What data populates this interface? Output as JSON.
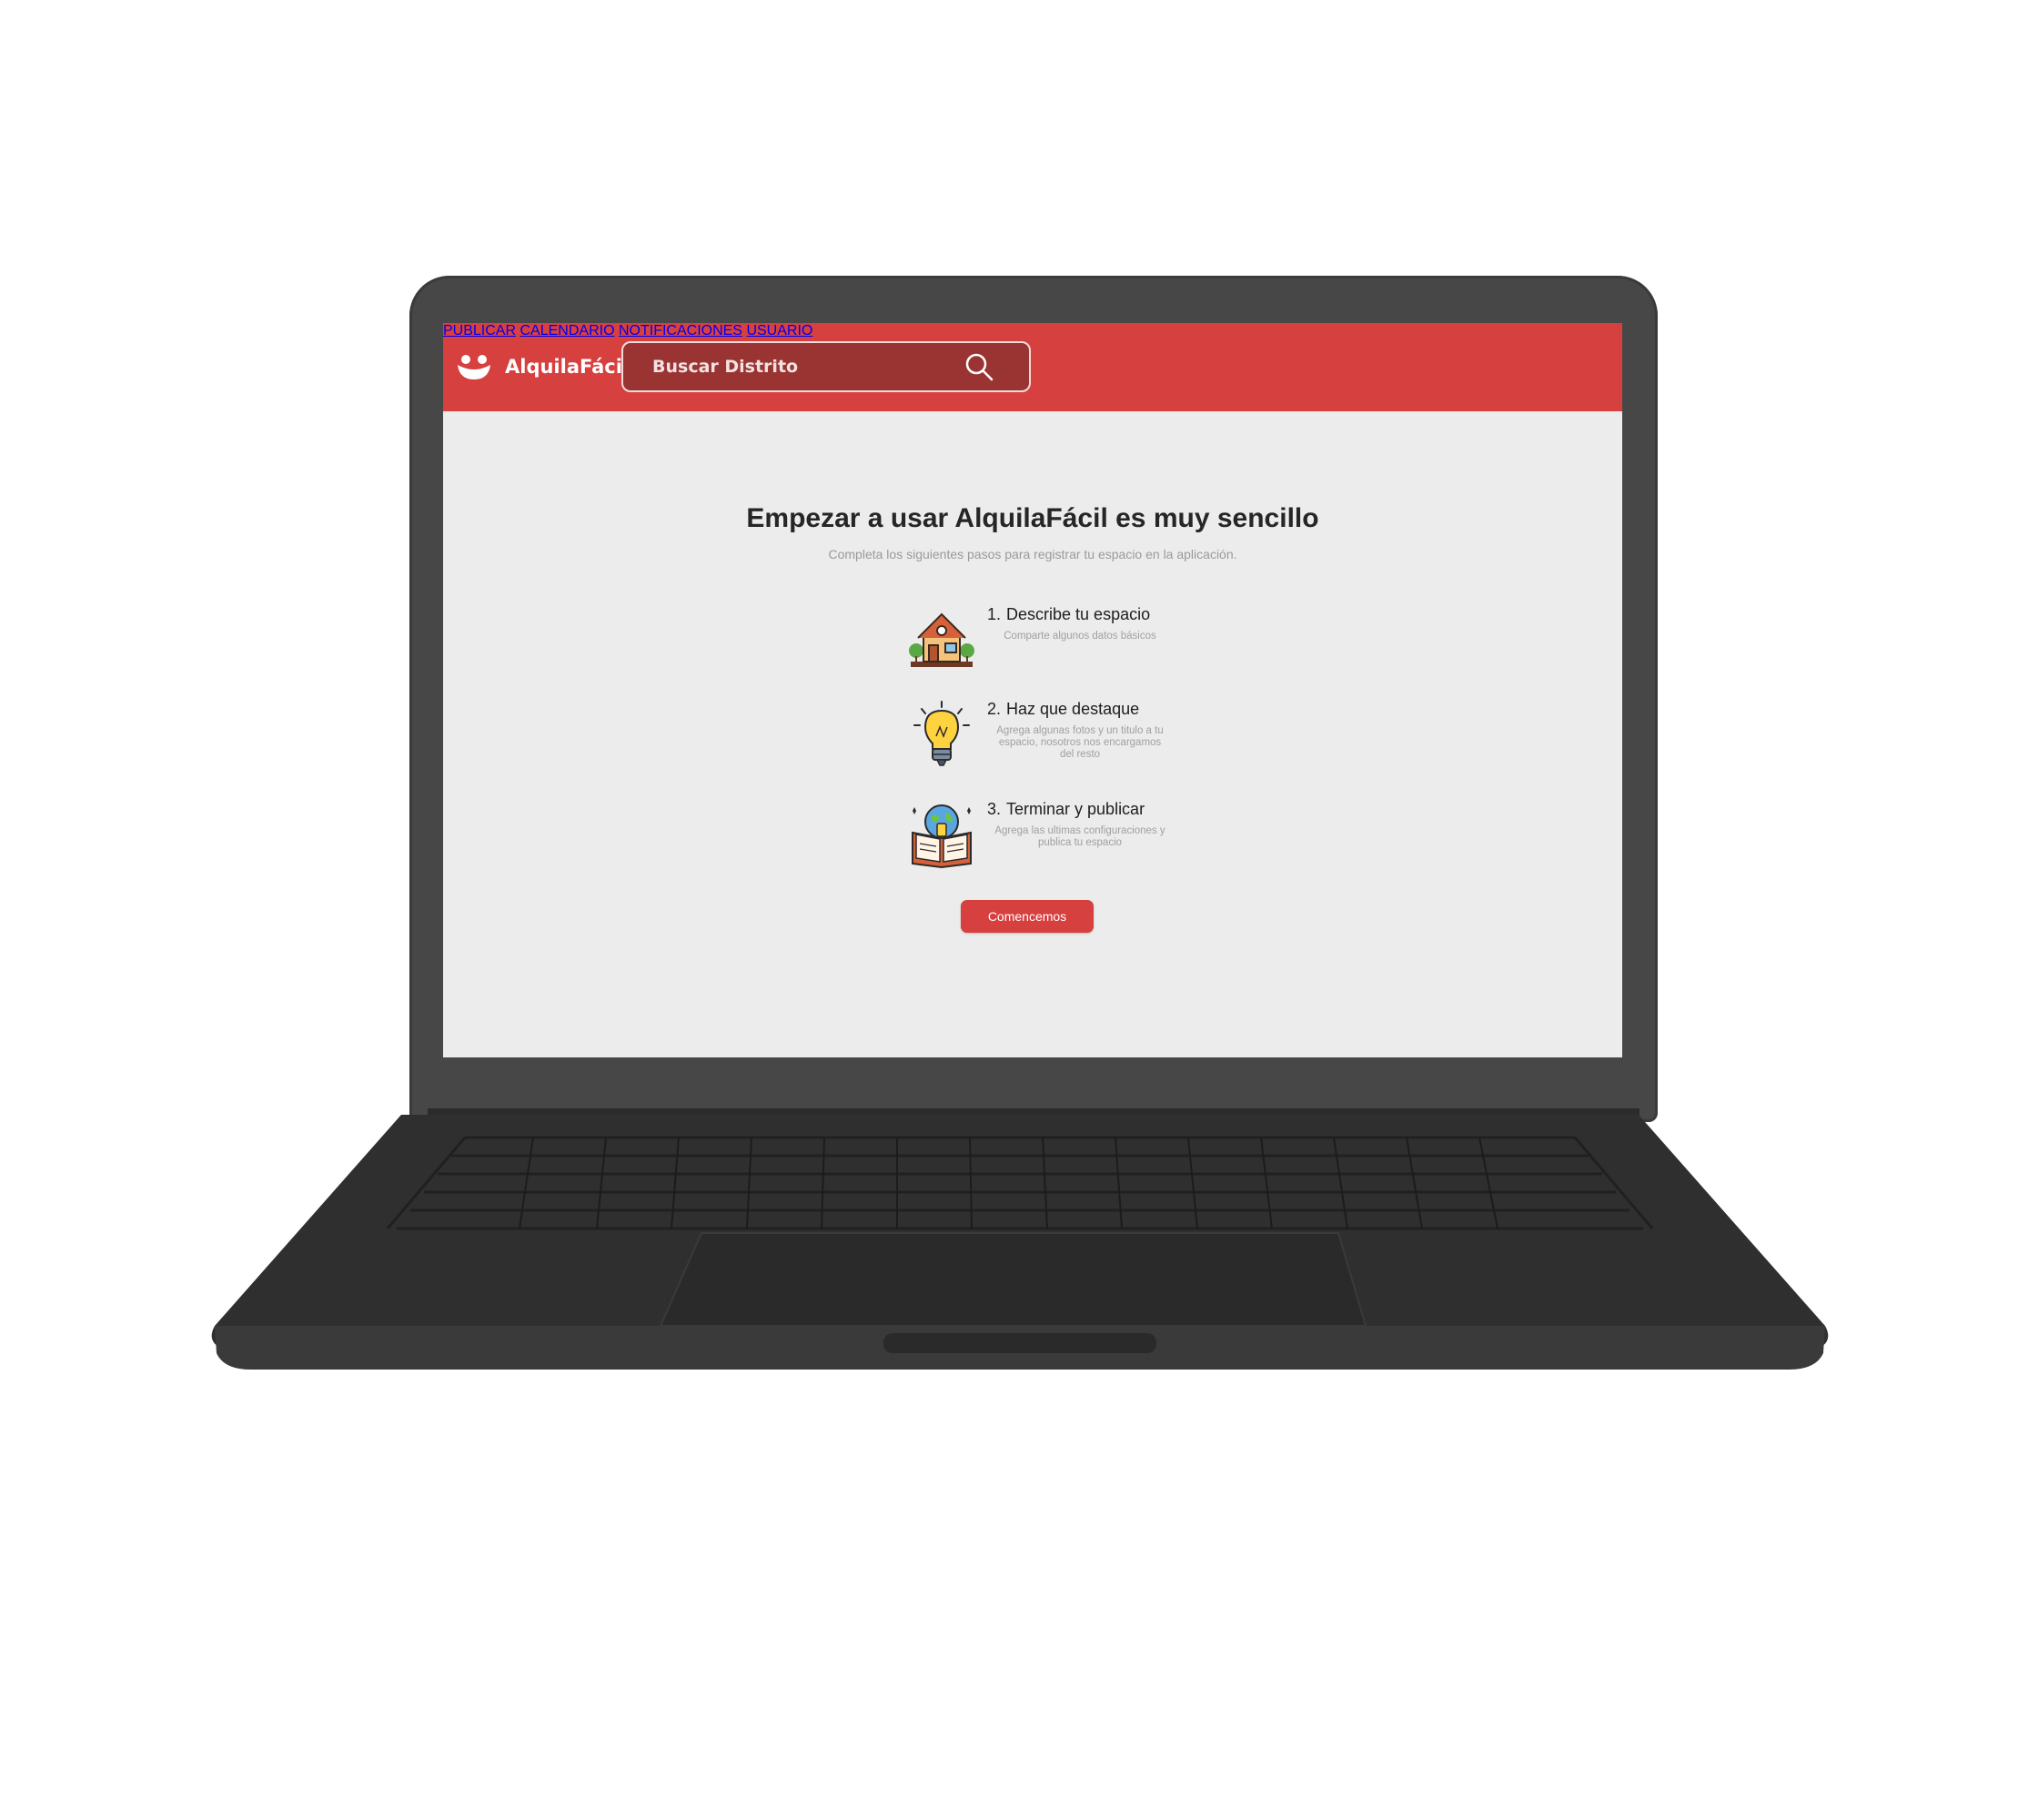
{
  "header": {
    "brand": "AlquilaFácil",
    "search": {
      "placeholder": "Buscar Distrito"
    },
    "nav": [
      "PUBLICAR",
      "CALENDARIO",
      "NOTIFICACIONES",
      "USUARIO"
    ]
  },
  "main": {
    "title": "Empezar a usar AlquilaFácil es muy sencillo",
    "subtitle": "Completa los siguientes pasos para registrar tu espacio en la aplicación.",
    "steps": [
      {
        "number": "1.",
        "title": "Describe tu espacio",
        "description": "Comparte algunos datos básicos",
        "icon": "house-icon"
      },
      {
        "number": "2.",
        "title": "Haz que destaque",
        "description": "Agrega algunas fotos y un titulo a tu espacio, nosotros nos encargamos del resto",
        "icon": "lightbulb-icon"
      },
      {
        "number": "3.",
        "title": "Terminar y publicar",
        "description": "Agrega las ultimas configuraciones y publica tu espacio",
        "icon": "globe-book-icon"
      }
    ],
    "cta_label": "Comencemos"
  },
  "colors": {
    "brand_red": "#d6403f",
    "search_bg": "#9a3432",
    "screen_bg": "#ececec",
    "laptop": "#474747"
  }
}
